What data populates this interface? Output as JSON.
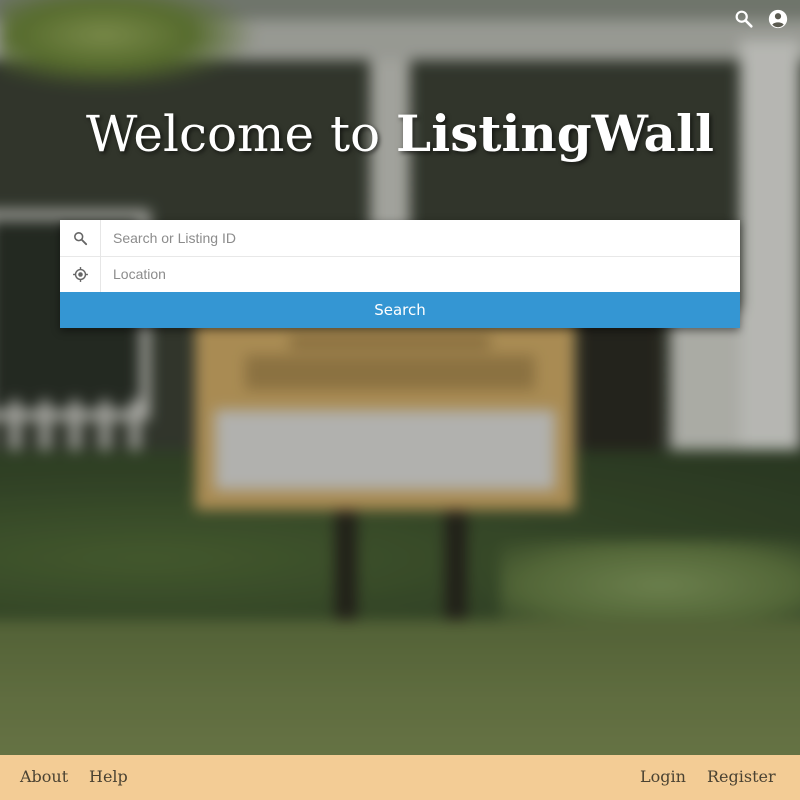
{
  "header": {
    "search_icon": "search-icon",
    "account_icon": "account-circle-icon"
  },
  "hero": {
    "welcome_text": "Welcome to",
    "brand_name": "ListingWall"
  },
  "search_form": {
    "query_placeholder": "Search or Listing ID",
    "query_value": "",
    "query_icon": "search-icon",
    "location_placeholder": "Location",
    "location_value": "",
    "location_icon": "crosshair-icon",
    "submit_label": "Search",
    "submit_color": "#3496d3"
  },
  "footer": {
    "background_color": "#f3cc95",
    "links_left": [
      "About",
      "Help"
    ],
    "links_right": [
      "Login",
      "Register"
    ]
  }
}
